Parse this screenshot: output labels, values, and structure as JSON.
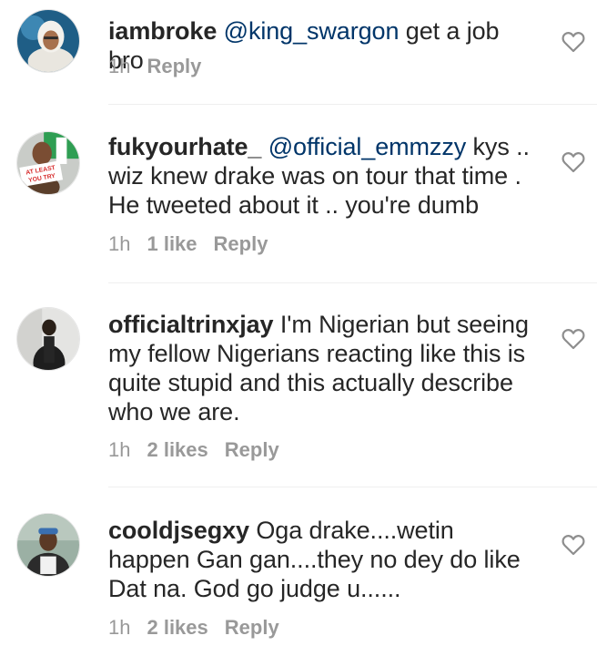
{
  "comments": [
    {
      "username": "iambroke",
      "mention": "@king_swargon",
      "text": " get a job bro",
      "time": "1h",
      "likes": "",
      "reply_label": "Reply",
      "avatar_icon": "avatar-white-hoodie"
    },
    {
      "username": "fukyourhate_",
      "mention": "@official_emmzzy",
      "text": " kys .. wiz knew drake was on tour that time . He tweeted about it .. you're dumb",
      "time": "1h",
      "likes": "1 like",
      "reply_label": "Reply",
      "avatar_icon": "avatar-sign-red-green",
      "avatar_text": "AT LEAST YOU TRY"
    },
    {
      "username": "officialtrinxjay",
      "mention": "",
      "text": " I'm Nigerian but seeing my fellow Nigerians reacting like this is quite stupid and this actually describe who we are.",
      "time": "1h",
      "likes": "2 likes",
      "reply_label": "Reply",
      "avatar_icon": "avatar-man-dark"
    },
    {
      "username": "cooldjsegxy",
      "mention": "",
      "text": " Oga drake....wetin happen Gan gan....they no dey do like Dat na. God go judge u......",
      "time": "1h",
      "likes": "2 likes",
      "reply_label": "Reply",
      "avatar_icon": "avatar-man-cap"
    }
  ],
  "colors": {
    "text": "#262626",
    "mention": "#003569",
    "meta": "#999999",
    "heart": "#8e8e8e",
    "divider": "#efefef"
  }
}
